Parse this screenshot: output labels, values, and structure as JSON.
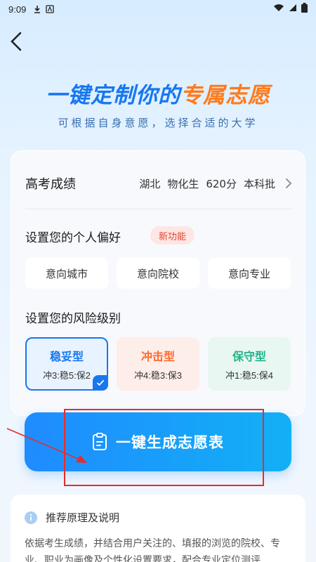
{
  "status_bar": {
    "time": "9:09"
  },
  "hero": {
    "title_part1": "一键定制你的",
    "title_part2": "专属志愿",
    "subtitle": "可根据自身意愿，选择合适的大学"
  },
  "score": {
    "label": "高考成绩",
    "province": "湖北",
    "subjects": "物化生",
    "points": "620分",
    "batch": "本科批"
  },
  "preferences": {
    "title": "设置您的个人偏好",
    "badge": "新功能",
    "options": [
      "意向城市",
      "意向院校",
      "意向专业"
    ]
  },
  "risk": {
    "title": "设置您的风险级别",
    "levels": [
      {
        "name": "稳妥型",
        "ratio": "冲3:稳5:保2",
        "selected": true,
        "color": "#1677f0"
      },
      {
        "name": "冲击型",
        "ratio": "冲4:稳3:保3",
        "selected": false,
        "color": "#ff6a2c"
      },
      {
        "name": "保守型",
        "ratio": "冲1:稳5:保4",
        "selected": false,
        "color": "#22b38a"
      }
    ]
  },
  "generate_button": {
    "label": "一键生成志愿表"
  },
  "info": {
    "title": "推荐原理及说明",
    "text": "依据考生成绩，并结合用户关注的、填报的浏览的院校、专业、职业为画像及个性化设置要求，配合专业定位测评"
  },
  "colors": {
    "accent": "#1677f0",
    "highlight": "#ff7a1a",
    "annotation": "#e52d2d"
  }
}
